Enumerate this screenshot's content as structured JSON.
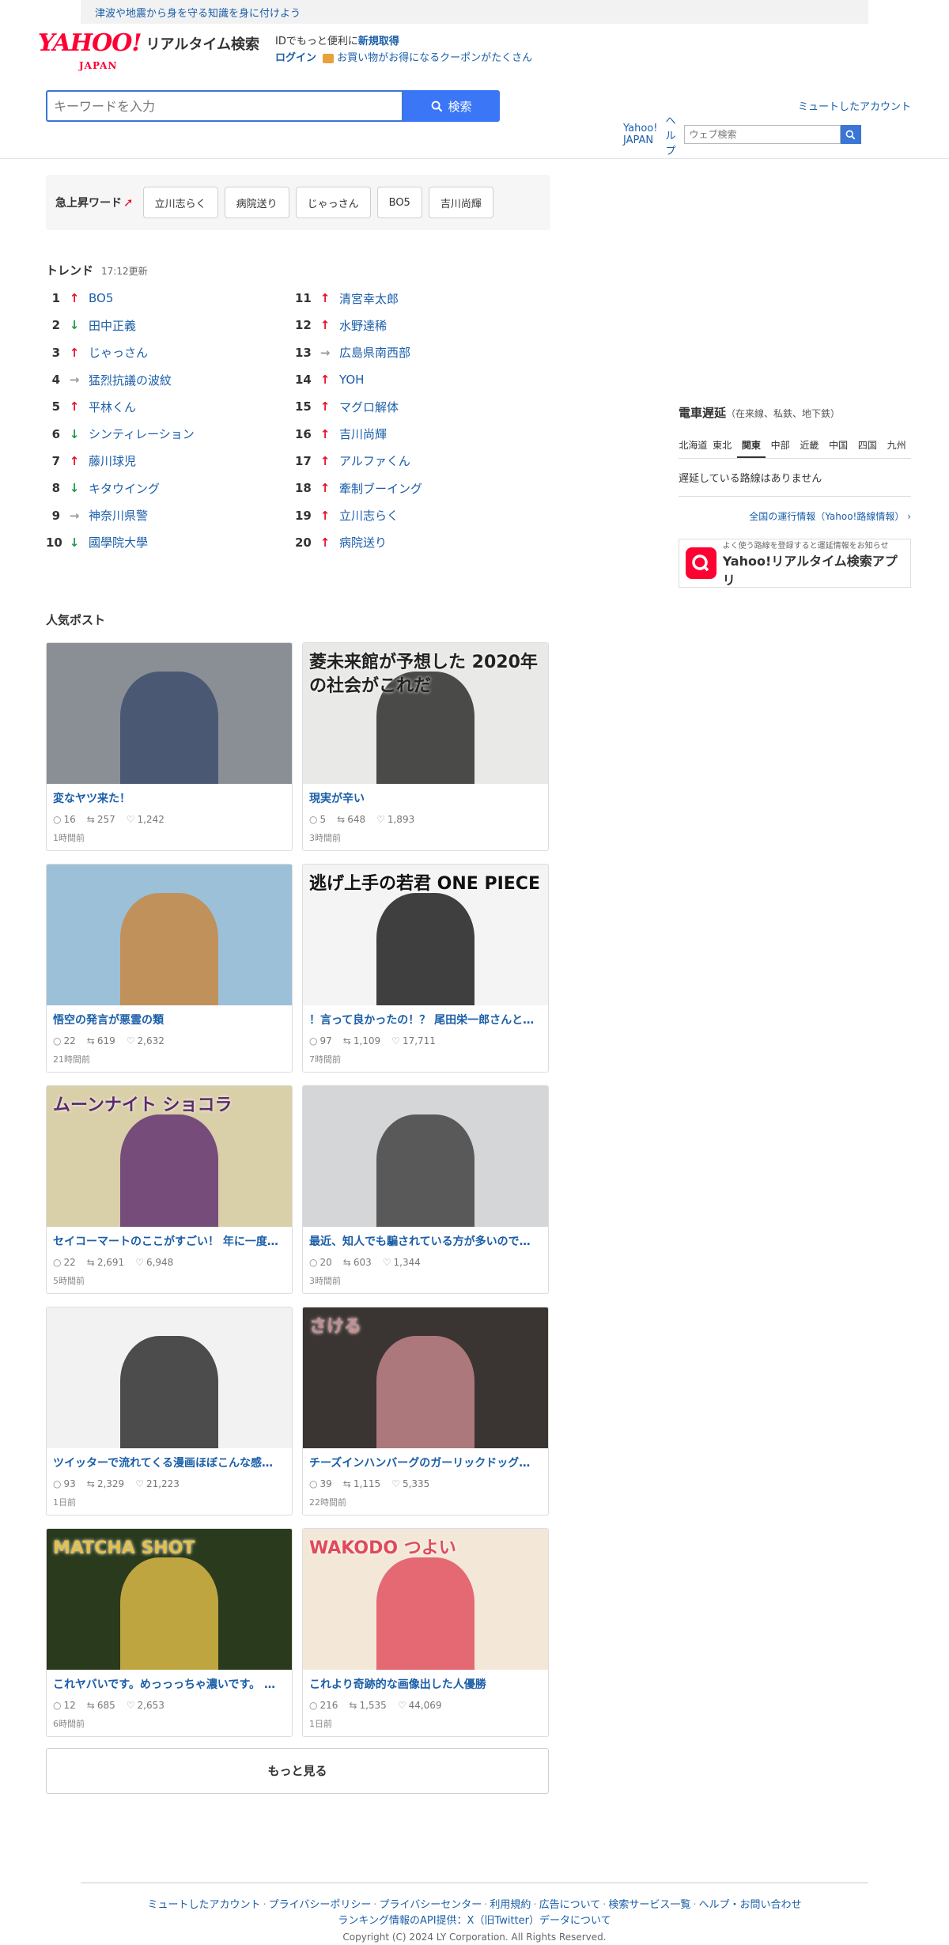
{
  "topbar": {
    "notice": "津波や地震から身を守る知識を身に付けよう",
    "yahoo_japan": "Yahoo! JAPAN",
    "help": "ヘルプ",
    "web_search_placeholder": "ウェブ検索"
  },
  "header": {
    "logo_text": "YAHOO!",
    "logo_sub": "JAPAN",
    "service_name": "リアルタイム検索",
    "id_line1_prefix": "IDでもっと便利に",
    "id_line1_link": "新規取得",
    "login": "ログイン",
    "coupon_text": "お買い物がお得になるクーポンがたくさん"
  },
  "search": {
    "placeholder": "キーワードを入力",
    "button": "検索",
    "muted_accounts": "ミュートしたアカウント"
  },
  "rising": {
    "label": "急上昇ワード",
    "words": [
      "立川志らく",
      "病院送り",
      "じゃっさん",
      "BO5",
      "吉川尚輝"
    ]
  },
  "trend": {
    "title": "トレンド",
    "updated": "17:12更新",
    "items": [
      {
        "rank": "1",
        "dir": "up",
        "word": "BO5"
      },
      {
        "rank": "2",
        "dir": "down",
        "word": "田中正義"
      },
      {
        "rank": "3",
        "dir": "up",
        "word": "じゃっさん"
      },
      {
        "rank": "4",
        "dir": "flat",
        "word": "猛烈抗議の波紋"
      },
      {
        "rank": "5",
        "dir": "up",
        "word": "平林くん"
      },
      {
        "rank": "6",
        "dir": "down",
        "word": "シンティレーション"
      },
      {
        "rank": "7",
        "dir": "up",
        "word": "藤川球児"
      },
      {
        "rank": "8",
        "dir": "down",
        "word": "キタウイング"
      },
      {
        "rank": "9",
        "dir": "flat",
        "word": "神奈川県警"
      },
      {
        "rank": "10",
        "dir": "down",
        "word": "國學院大學"
      },
      {
        "rank": "11",
        "dir": "up",
        "word": "清宮幸太郎"
      },
      {
        "rank": "12",
        "dir": "up",
        "word": "水野達稀"
      },
      {
        "rank": "13",
        "dir": "flat",
        "word": "広島県南西部"
      },
      {
        "rank": "14",
        "dir": "up",
        "word": "YOH"
      },
      {
        "rank": "15",
        "dir": "up",
        "word": "マグロ解体"
      },
      {
        "rank": "16",
        "dir": "up",
        "word": "吉川尚輝"
      },
      {
        "rank": "17",
        "dir": "up",
        "word": "アルファくん"
      },
      {
        "rank": "18",
        "dir": "up",
        "word": "牽制ブーイング"
      },
      {
        "rank": "19",
        "dir": "up",
        "word": "立川志らく"
      },
      {
        "rank": "20",
        "dir": "up",
        "word": "病院送り"
      }
    ]
  },
  "popular": {
    "title": "人気ポスト",
    "posts": [
      {
        "title": "変なヤツ来た！",
        "replies": "16",
        "reposts": "257",
        "likes": "1,242",
        "time": "1時間前",
        "img_bg": "#8a8f96",
        "img_accent": "#3b4a6b",
        "img_text": ""
      },
      {
        "title": "現実が辛い",
        "replies": "5",
        "reposts": "648",
        "likes": "1,893",
        "time": "3時間前",
        "img_bg": "#e9e9e7",
        "img_accent": "#222",
        "img_text": "菱未来館が予想した 2020年の社会がこれだ"
      },
      {
        "title": "悟空の発言が悪霊の類",
        "replies": "22",
        "reposts": "619",
        "likes": "2,632",
        "time": "21時間前",
        "img_bg": "#9bc0d8",
        "img_accent": "#c9853b",
        "img_text": ""
      },
      {
        "title": "！言って良かったの！？ 尾田栄一郎さんと…",
        "replies": "97",
        "reposts": "1,109",
        "likes": "17,711",
        "time": "7時間前",
        "img_bg": "#f4f4f4",
        "img_accent": "#111",
        "img_text": "逃げ上手の若君 ONE PIECE"
      },
      {
        "title": "セイコーマートのここがすごい！ 年に一度…",
        "replies": "22",
        "reposts": "2,691",
        "likes": "6,948",
        "time": "5時間前",
        "img_bg": "#d9cfa9",
        "img_accent": "#5b2a6e",
        "img_text": "ムーンナイト ショコラ"
      },
      {
        "title": "最近、知人でも騙されている方が多いので…",
        "replies": "20",
        "reposts": "603",
        "likes": "1,344",
        "time": "3時間前",
        "img_bg": "#d4d6d8",
        "img_accent": "#3a3a3a",
        "img_text": ""
      },
      {
        "title": "ツイッターで流れてくる漫画ほぼこんな感…",
        "replies": "93",
        "reposts": "2,329",
        "likes": "21,223",
        "time": "1日前",
        "img_bg": "#f2f2f2",
        "img_accent": "#222",
        "img_text": ""
      },
      {
        "title": "チーズインハンバーグのガーリックドッグ…",
        "replies": "39",
        "reposts": "1,115",
        "likes": "5,335",
        "time": "22時間前",
        "img_bg": "#3a3532",
        "img_accent": "#c98a8f",
        "img_text": "さける"
      },
      {
        "title": "これヤバいです。めっっっちゃ濃いです。 …",
        "replies": "12",
        "reposts": "685",
        "likes": "2,653",
        "time": "6時間前",
        "img_bg": "#2a3a1c",
        "img_accent": "#e3c04a",
        "img_text": "MATCHA SHOT"
      },
      {
        "title": "これより奇跡的な画像出した人優勝",
        "replies": "216",
        "reposts": "1,535",
        "likes": "44,069",
        "time": "1日前",
        "img_bg": "#f3e7d8",
        "img_accent": "#e04a5a",
        "img_text": "WAKODO つよい"
      }
    ],
    "more": "もっと見る"
  },
  "train": {
    "title": "電車遅延",
    "subtitle": "（在来線、私鉄、地下鉄）",
    "regions": [
      "北海道",
      "東北",
      "関東",
      "中部",
      "近畿",
      "中国",
      "四国",
      "九州"
    ],
    "active_region": "関東",
    "message": "遅延している路線はありません",
    "link": "全国の運行情報（Yahoo!路線情報）"
  },
  "app_banner": {
    "small": "よく使う路線を登録すると運延情報をお知らせ",
    "name": "Yahoo!リアルタイム検索アプリ"
  },
  "footer": {
    "links": [
      "ミュートしたアカウント",
      "プライバシーポリシー",
      "プライバシーセンター",
      "利用規約",
      "広告について",
      "検索サービス一覧",
      "ヘルプ・お問い合わせ"
    ],
    "api_line": "ランキング情報のAPI提供：X（旧Twitter）データについて",
    "copyright": "Copyright (C) 2024 LY Corporation. All Rights Reserved."
  },
  "colors": {
    "link": "#1a5ea8",
    "brand_red": "#ff0033",
    "search_blue": "#3b76f6",
    "up": "#e8112d",
    "down": "#1e9b48"
  }
}
